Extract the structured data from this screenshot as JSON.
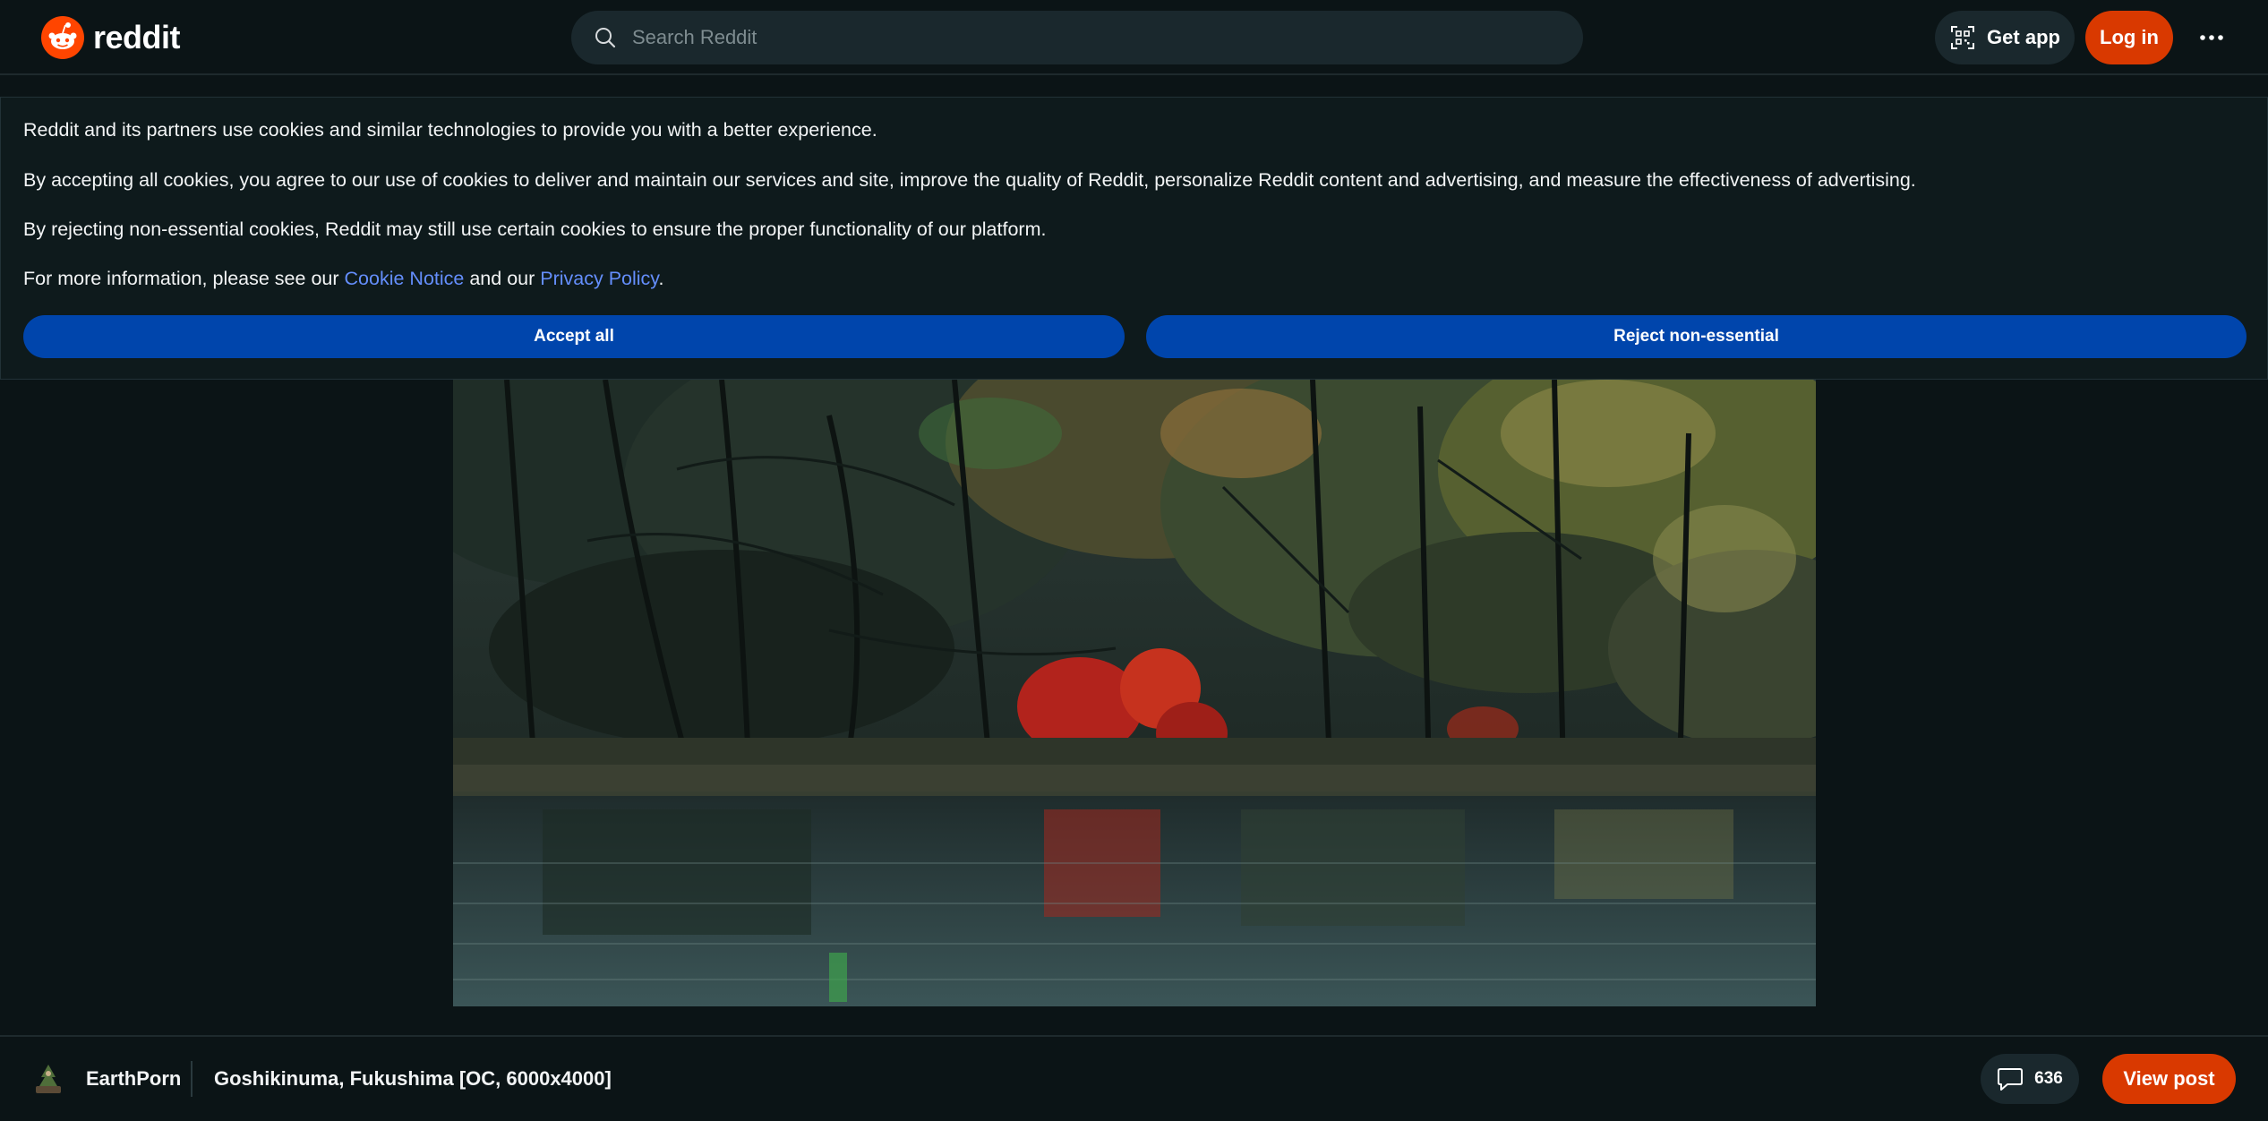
{
  "header": {
    "logo_text": "reddit",
    "search_placeholder": "Search Reddit",
    "get_app_label": "Get app",
    "login_label": "Log in",
    "more_icon": "ellipsis-icon"
  },
  "cookie_banner": {
    "line1": "Reddit and its partners use cookies and similar technologies to provide you with a better experience.",
    "line2": "By accepting all cookies, you agree to our use of cookies to deliver and maintain our services and site, improve the quality of Reddit, personalize Reddit content and advertising, and measure the effectiveness of advertising.",
    "line3": "By rejecting non-essential cookies, Reddit may still use certain cookies to ensure the proper functionality of our platform.",
    "line4_prefix": "For more information, please see our",
    "cookie_notice_link": "Cookie Notice",
    "line4_middle": "and our",
    "privacy_policy_link": "Privacy Policy",
    "line4_suffix": ".",
    "accept_label": "Accept all",
    "reject_label": "Reject non-essential"
  },
  "post": {
    "subreddit": "EarthPorn",
    "title": "Goshikinuma, Fukushima [OC, 6000x4000]",
    "comment_count": "636",
    "view_post_label": "View post"
  },
  "colors": {
    "background": "#0b1416",
    "brand_orange": "#d93900",
    "cookie_button_blue": "#0045ac",
    "link_blue": "#648efc"
  }
}
